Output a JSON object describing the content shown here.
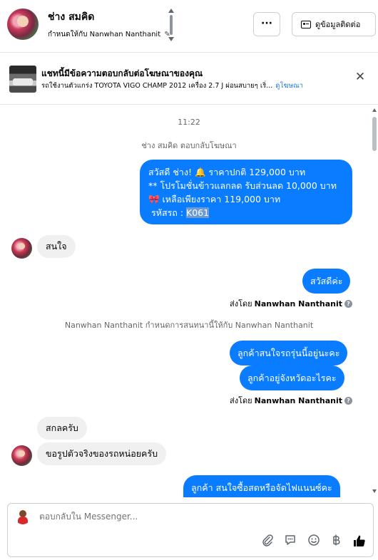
{
  "header": {
    "contact_name": "ช่าง สมคิด",
    "assigned_to": "กำหนดให้กับ Nanwhan Nanthanit",
    "more_label": "···",
    "contact_info_label": "ดูข้อมูลติดต่อ"
  },
  "ad": {
    "title": "แชทนี้มีข้อความตอบกลับต่อโฆษณาของคุณ",
    "subtitle": "รถใช้งานตัวแกร่ง TOYOTA VIGO CHAMP 2012 เครื่อง 2.7 J ผ่อนสบายๆ เริ่...",
    "link": "ดูโฆษณา",
    "close": "✕"
  },
  "chat": {
    "timestamp": "11:22",
    "reply_to_ad_note": "ช่าง สมคิด ตอบกลับโฆษณา",
    "offer_lines": [
      "สวัสดี ช่าง! 🔔 ราคาปกติ 129,000 บาท",
      "** โปรโมชั่นข้าวแลกลด รับส่วนลด 10,000 บาท",
      "🎀 เหลือเพียงราคา 119,000 บาท"
    ],
    "offer_code_label": "รหัสรถ : ",
    "offer_code": "K061",
    "msg_interested": "สนใจ",
    "msg_hello": "สวัสดีค่ะ",
    "sent_by_label": "ส่งโดย",
    "agent_name": "Nanwhan Nanthanit",
    "assignment_note": "Nanwhan Nanthanit กำหนดการสนทนานี้ให้กับ Nanwhan Nanthanit",
    "msg_q1": "ลูกค้าสนใจรถรุ่นนี้อยู่นะคะ",
    "msg_q2": "ลูกค้าอยู่จังหวัดอะไรคะ",
    "msg_province": "สกลครับ",
    "msg_photo_request": "ขอรูปตัวจริงของรถหน่อยครับ",
    "msg_partial": "ลูกค้า สนใจซื้อสดหรือจัดไฟแนนซ์คะ",
    "help_glyph": "?"
  },
  "composer": {
    "placeholder": "ตอบกลับใน Messenger..."
  },
  "colors": {
    "outgoing_bubble": "#0a7cff",
    "incoming_bubble": "#f0f0f0",
    "link": "#1877f2"
  },
  "icons": [
    "pencil-icon",
    "id-card-icon",
    "close-icon",
    "attachment-icon",
    "saved-replies-icon",
    "emoji-icon",
    "baht-icon",
    "like-icon"
  ]
}
